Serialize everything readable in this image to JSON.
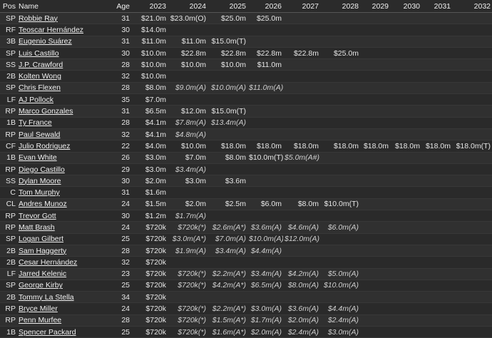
{
  "columns": [
    "Pos",
    "Name",
    "Age",
    "2023",
    "2024",
    "2025",
    "2026",
    "2027",
    "2028",
    "2029",
    "2030",
    "2031",
    "2032"
  ],
  "rows": [
    {
      "pos": "SP",
      "name": "Robbie Ray",
      "age": "31",
      "vals": [
        "$21.0m",
        "$23.0m(O)",
        "$25.0m",
        "$25.0m",
        "",
        "",
        "",
        "",
        "",
        ""
      ]
    },
    {
      "pos": "RF",
      "name": "Teoscar Hernández",
      "age": "30",
      "vals": [
        "$14.0m",
        "",
        "",
        "",
        "",
        "",
        "",
        "",
        "",
        ""
      ]
    },
    {
      "pos": "3B",
      "name": "Eugenio Suárez",
      "age": "31",
      "vals": [
        "$11.0m",
        "$11.0m",
        "$15.0m(T)",
        "",
        "",
        "",
        "",
        "",
        "",
        ""
      ]
    },
    {
      "pos": "SP",
      "name": "Luis Castillo",
      "age": "30",
      "vals": [
        "$10.0m",
        "$22.8m",
        "$22.8m",
        "$22.8m",
        "$22.8m",
        "$25.0m",
        "",
        "",
        "",
        ""
      ]
    },
    {
      "pos": "SS",
      "name": "J.P. Crawford",
      "age": "28",
      "vals": [
        "$10.0m",
        "$10.0m",
        "$10.0m",
        "$11.0m",
        "",
        "",
        "",
        "",
        "",
        ""
      ]
    },
    {
      "pos": "2B",
      "name": "Kolten Wong",
      "age": "32",
      "vals": [
        "$10.0m",
        "",
        "",
        "",
        "",
        "",
        "",
        "",
        "",
        ""
      ]
    },
    {
      "pos": "SP",
      "name": "Chris Flexen",
      "age": "28",
      "vals": [
        "$8.0m",
        "$9.0m(A)",
        "$10.0m(A)",
        "$11.0m(A)",
        "",
        "",
        "",
        "",
        "",
        ""
      ]
    },
    {
      "pos": "LF",
      "name": "AJ Pollock",
      "age": "35",
      "vals": [
        "$7.0m",
        "",
        "",
        "",
        "",
        "",
        "",
        "",
        "",
        ""
      ]
    },
    {
      "pos": "RP",
      "name": "Marco Gonzales",
      "age": "31",
      "vals": [
        "$6.5m",
        "$12.0m",
        "$15.0m(T)",
        "",
        "",
        "",
        "",
        "",
        "",
        ""
      ]
    },
    {
      "pos": "1B",
      "name": "Ty France",
      "age": "28",
      "vals": [
        "$4.1m",
        "$7.8m(A)",
        "$13.4m(A)",
        "",
        "",
        "",
        "",
        "",
        "",
        ""
      ]
    },
    {
      "pos": "RP",
      "name": "Paul Sewald",
      "age": "32",
      "vals": [
        "$4.1m",
        "$4.8m(A)",
        "",
        "",
        "",
        "",
        "",
        "",
        "",
        ""
      ]
    },
    {
      "pos": "CF",
      "name": "Julio Rodriguez",
      "age": "22",
      "vals": [
        "$4.0m",
        "$10.0m",
        "$18.0m",
        "$18.0m",
        "$18.0m",
        "$18.0m",
        "$18.0m",
        "$18.0m",
        "$18.0m",
        "$18.0m(T)"
      ]
    },
    {
      "pos": "1B",
      "name": "Evan White",
      "age": "26",
      "vals": [
        "$3.0m",
        "$7.0m",
        "$8.0m",
        "$10.0m(T)",
        "$5.0m(A#)",
        "",
        "",
        "",
        "",
        ""
      ]
    },
    {
      "pos": "RP",
      "name": "Diego Castillo",
      "age": "29",
      "vals": [
        "$3.0m",
        "$3.4m(A)",
        "",
        "",
        "",
        "",
        "",
        "",
        "",
        ""
      ]
    },
    {
      "pos": "SS",
      "name": "Dylan Moore",
      "age": "30",
      "vals": [
        "$2.0m",
        "$3.0m",
        "$3.6m",
        "",
        "",
        "",
        "",
        "",
        "",
        ""
      ]
    },
    {
      "pos": "C",
      "name": "Tom Murphy",
      "age": "31",
      "vals": [
        "$1.6m",
        "",
        "",
        "",
        "",
        "",
        "",
        "",
        "",
        ""
      ]
    },
    {
      "pos": "CL",
      "name": "Andres Munoz",
      "age": "24",
      "vals": [
        "$1.5m",
        "$2.0m",
        "$2.5m",
        "$6.0m",
        "$8.0m",
        "$10.0m(T)",
        "",
        "",
        "",
        ""
      ]
    },
    {
      "pos": "RP",
      "name": "Trevor Gott",
      "age": "30",
      "vals": [
        "$1.2m",
        "$1.7m(A)",
        "",
        "",
        "",
        "",
        "",
        "",
        "",
        ""
      ]
    },
    {
      "pos": "RP",
      "name": "Matt Brash",
      "age": "24",
      "vals": [
        "$720k",
        "$720k(*)",
        "$2.6m(A*)",
        "$3.6m(A)",
        "$4.6m(A)",
        "$6.0m(A)",
        "",
        "",
        "",
        ""
      ]
    },
    {
      "pos": "SP",
      "name": "Logan Gilbert",
      "age": "25",
      "vals": [
        "$720k",
        "$3.0m(A*)",
        "$7.0m(A)",
        "$10.0m(A)",
        "$12.0m(A)",
        "",
        "",
        "",
        "",
        ""
      ]
    },
    {
      "pos": "2B",
      "name": "Sam Haggerty",
      "age": "28",
      "vals": [
        "$720k",
        "$1.9m(A)",
        "$3.4m(A)",
        "$4.4m(A)",
        "",
        "",
        "",
        "",
        "",
        ""
      ]
    },
    {
      "pos": "2B",
      "name": "Cesar Hernández",
      "age": "32",
      "vals": [
        "$720k",
        "",
        "",
        "",
        "",
        "",
        "",
        "",
        "",
        ""
      ]
    },
    {
      "pos": "LF",
      "name": "Jarred Kelenic",
      "age": "23",
      "vals": [
        "$720k",
        "$720k(*)",
        "$2.2m(A*)",
        "$3.4m(A)",
        "$4.2m(A)",
        "$5.0m(A)",
        "",
        "",
        "",
        ""
      ]
    },
    {
      "pos": "SP",
      "name": "George Kirby",
      "age": "25",
      "vals": [
        "$720k",
        "$720k(*)",
        "$4.2m(A*)",
        "$6.5m(A)",
        "$8.0m(A)",
        "$10.0m(A)",
        "",
        "",
        "",
        ""
      ]
    },
    {
      "pos": "2B",
      "name": "Tommy La Stella",
      "age": "34",
      "vals": [
        "$720k",
        "",
        "",
        "",
        "",
        "",
        "",
        "",
        "",
        ""
      ]
    },
    {
      "pos": "RP",
      "name": "Bryce Miller",
      "age": "24",
      "vals": [
        "$720k",
        "$720k(*)",
        "$2.2m(A*)",
        "$3.0m(A)",
        "$3.6m(A)",
        "$4.4m(A)",
        "",
        "",
        "",
        ""
      ]
    },
    {
      "pos": "RP",
      "name": "Penn Murfee",
      "age": "28",
      "vals": [
        "$720k",
        "$720k(*)",
        "$1.5m(A*)",
        "$1.7m(A)",
        "$2.0m(A)",
        "$2.4m(A)",
        "",
        "",
        "",
        ""
      ]
    },
    {
      "pos": "1B",
      "name": "Spencer Packard",
      "age": "25",
      "vals": [
        "$720k",
        "$720k(*)",
        "$1.6m(A*)",
        "$2.0m(A)",
        "$2.4m(A)",
        "$3.0m(A)",
        "",
        "",
        "",
        ""
      ]
    }
  ]
}
